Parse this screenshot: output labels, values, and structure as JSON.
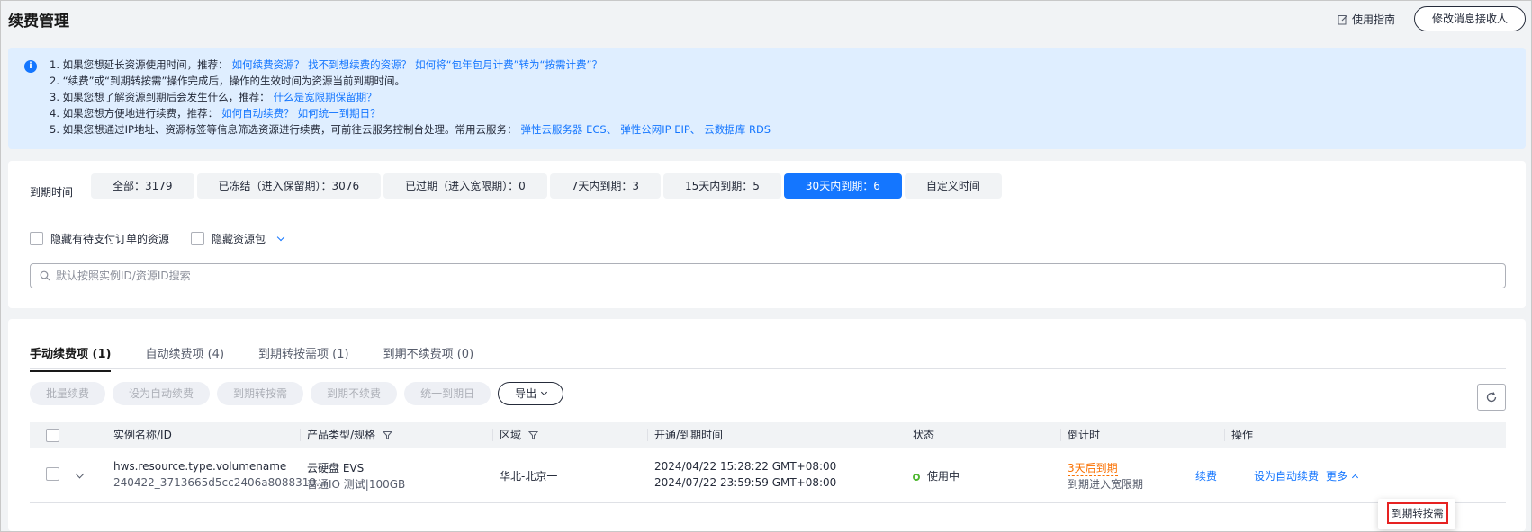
{
  "header": {
    "title": "续费管理",
    "guide_label": "使用指南",
    "modify_label": "修改消息接收人"
  },
  "notice": {
    "lines": [
      {
        "prefix": "1. 如果您想延长资源使用时间，推荐：",
        "links": [
          "如何续费资源？",
          "找不到想续费的资源？",
          "如何将“包年包月计费”转为“按需计费”？"
        ]
      },
      {
        "prefix": "2. “续费”或“到期转按需”操作完成后，操作的生效时间为资源当前到期时间。",
        "links": []
      },
      {
        "prefix": "3. 如果您想了解资源到期后会发生什么，推荐：",
        "links": [
          "什么是宽限期保留期？"
        ]
      },
      {
        "prefix": "4. 如果您想方便地进行续费，推荐：",
        "links": [
          "如何自动续费？",
          "如何统一到期日？"
        ]
      },
      {
        "prefix": "5. 如果您想通过IP地址、资源标签等信息筛选资源进行续费，可前往云服务控制台处理。常用云服务：",
        "links": [
          "弹性云服务器 ECS、",
          "弹性公网IP EIP、",
          "云数据库 RDS"
        ]
      }
    ]
  },
  "filter": {
    "label": "到期时间",
    "chips": [
      {
        "label": "全部：3179"
      },
      {
        "label": "已冻结（进入保留期）：3076"
      },
      {
        "label": "已过期（进入宽限期）：0"
      },
      {
        "label": "7天内到期：3"
      },
      {
        "label": "15天内到期：5"
      },
      {
        "label": "30天内到期：6"
      },
      {
        "label": "自定义时间"
      }
    ],
    "active_index": 5,
    "hide_pending": "隐藏有待支付订单的资源",
    "hide_package": "隐藏资源包",
    "search_placeholder": "默认按照实例ID/资源ID搜索"
  },
  "tabs": [
    {
      "label": "手动续费项 (1)"
    },
    {
      "label": "自动续费项 (4)"
    },
    {
      "label": "到期转按需项 (1)"
    },
    {
      "label": "到期不续费项 (0)"
    }
  ],
  "actions": {
    "batch_renew": "批量续费",
    "set_auto": "设为自动续费",
    "to_ondemand": "到期转按需",
    "no_renew": "到期不续费",
    "unify": "统一到期日",
    "export": "导出"
  },
  "table": {
    "columns": [
      "实例名称/ID",
      "产品类型/规格",
      "区域",
      "开通/到期时间",
      "状态",
      "倒计时",
      "操作"
    ],
    "rows": [
      {
        "name": "hws.resource.type.volumename",
        "id": "240422_3713665d5cc2406a8088310...",
        "product": "云硬盘 EVS",
        "spec": "普通IO 测试|100GB",
        "region": "华北-北京一",
        "start": "2024/04/22 15:28:22 GMT+08:00",
        "end": "2024/07/22 23:59:59 GMT+08:00",
        "status": "使用中",
        "countdown": "3天后到期",
        "countdown_note": "到期进入宽限期",
        "op_renew": "续费",
        "op_auto": "设为自动续费",
        "op_more": "更多"
      }
    ]
  },
  "dropdown": {
    "item": "到期转按需"
  },
  "colors": {
    "accent": "#1476ff",
    "warning": "#fa7000",
    "status_ok": "#50b832",
    "highlight": "#e62222"
  }
}
